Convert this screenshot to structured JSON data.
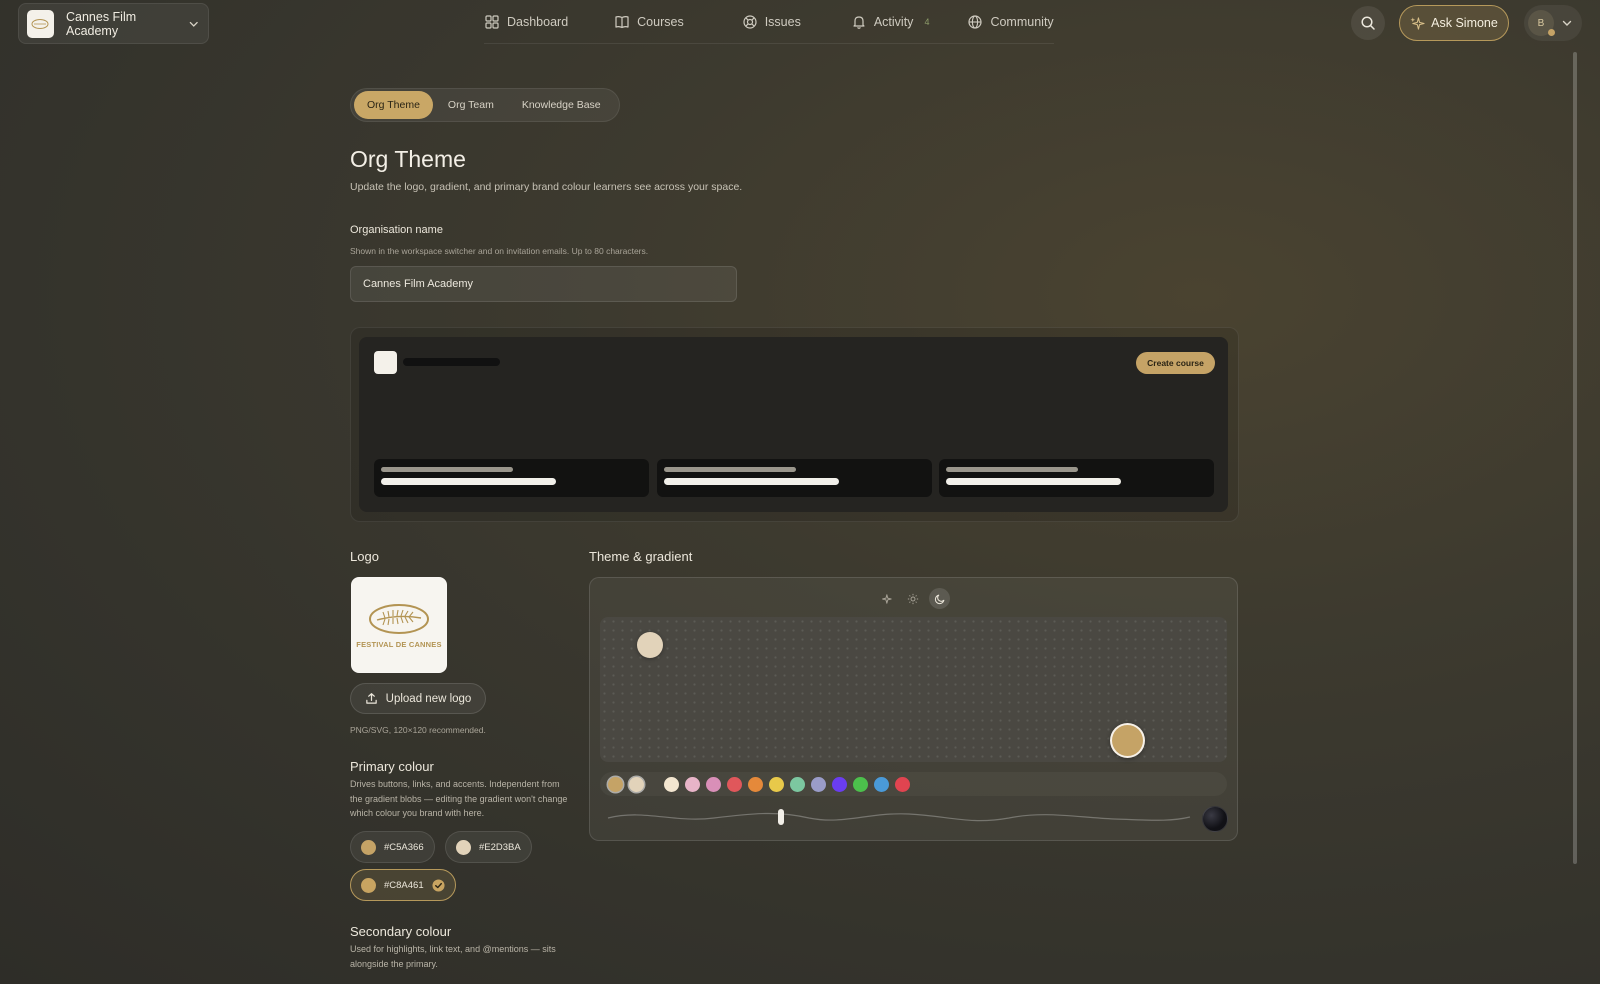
{
  "org_switcher": {
    "name": "Cannes Film Academy",
    "icon": "chevron-down-icon"
  },
  "nav": {
    "dashboard": "Dashboard",
    "courses": "Courses",
    "issues": "Issues",
    "activity": "Activity",
    "activity_badge": "4",
    "community": "Community"
  },
  "header_actions": {
    "ask_label": "Ask Simone",
    "avatar_initial": "B"
  },
  "subtabs": {
    "theme": "Org Theme",
    "team": "Org Team",
    "kb": "Knowledge Base"
  },
  "page": {
    "title": "Org Theme",
    "subtitle": "Update the logo, gradient, and primary brand colour learners see across your space."
  },
  "org_name_field": {
    "label": "Organisation name",
    "help": "Shown in the workspace switcher and on invitation emails. Up to 80 characters.",
    "value": "Cannes Film Academy"
  },
  "preview": {
    "create_label": "Create course"
  },
  "logo_section": {
    "title": "Logo",
    "logo_text": "FESTIVAL DE CANNES",
    "upload_label": "Upload new logo",
    "help": "PNG/SVG, 120×120 recommended."
  },
  "primary_colour": {
    "title": "Primary colour",
    "desc": "Drives buttons, links, and accents. Independent from the gradient blobs — editing the gradient won't change which colour you brand with here.",
    "options": [
      {
        "hex": "#C5A366",
        "color": "#C5A366",
        "selected": false
      },
      {
        "hex": "#E2D3BA",
        "color": "#E2D3BA",
        "selected": false
      },
      {
        "hex": "#C8A461",
        "color": "#C8A461",
        "selected": true
      }
    ]
  },
  "secondary_colour": {
    "title": "Secondary colour",
    "desc": "Used for highlights, link text, and @mentions — sits alongside the primary."
  },
  "theme_gradient": {
    "title": "Theme & gradient",
    "mode": "dark",
    "blob_colors": [
      "#E2D3BA",
      "#C5A366"
    ],
    "swatches": [
      "#C5A366",
      "#E2D3BA",
      "#F3E6D0",
      "#E8B4C8",
      "#D98FB8",
      "#E0575B",
      "#E5893A",
      "#E8C94A",
      "#7CC7A0",
      "#9A9CC8",
      "#6A3DF0",
      "#4CC04C",
      "#4A9AD8",
      "#E04450"
    ]
  }
}
